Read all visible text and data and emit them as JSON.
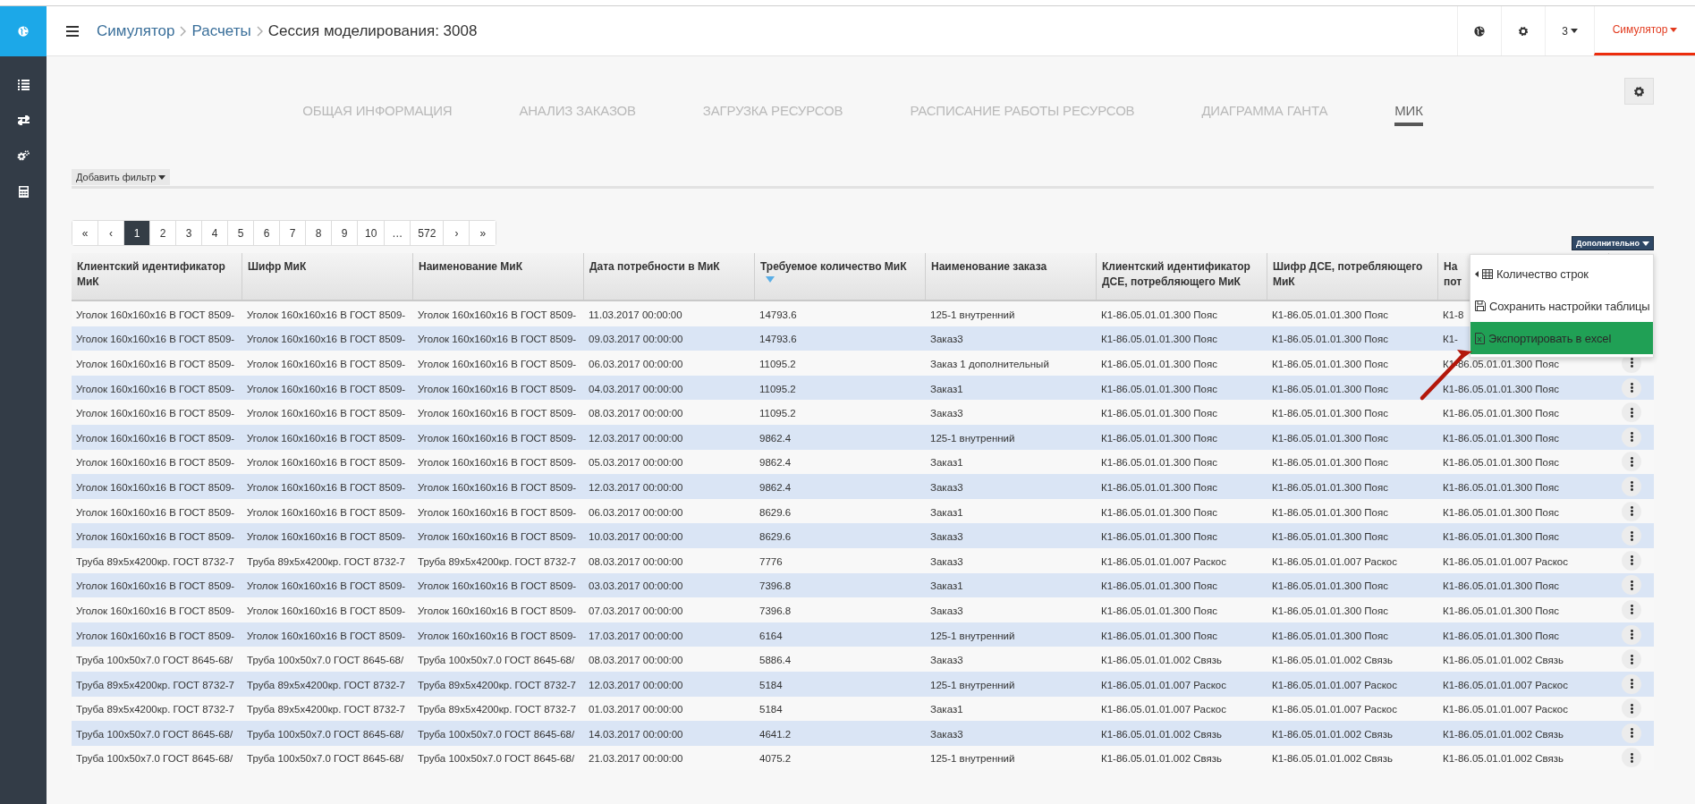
{
  "header": {
    "breadcrumbs": [
      "Симулятор",
      "Расчеты",
      "Сессия моделирования: 3008"
    ],
    "user_menu": "3",
    "app_menu": {
      "label": "Симулятор",
      "selected": true
    }
  },
  "tabs": [
    {
      "label": "ОБЩАЯ ИНФОРМАЦИЯ",
      "selected": false
    },
    {
      "label": "АНАЛИЗ ЗАКАЗОВ",
      "selected": false
    },
    {
      "label": "ЗАГРУЗКА РЕСУРСОВ",
      "selected": false
    },
    {
      "label": "РАСПИСАНИЕ РАБОТЫ РЕСУРСОВ",
      "selected": false
    },
    {
      "label": "ДИАГРАММА ГАНТА",
      "selected": false
    },
    {
      "label": "МИК",
      "selected": true
    }
  ],
  "filter_button": "Добавить фильтр",
  "pagination": [
    {
      "label": "«",
      "selected": false
    },
    {
      "label": "‹",
      "selected": false
    },
    {
      "label": "1",
      "selected": true
    },
    {
      "label": "2",
      "selected": false
    },
    {
      "label": "3",
      "selected": false
    },
    {
      "label": "4",
      "selected": false
    },
    {
      "label": "5",
      "selected": false
    },
    {
      "label": "6",
      "selected": false
    },
    {
      "label": "7",
      "selected": false
    },
    {
      "label": "8",
      "selected": false
    },
    {
      "label": "9",
      "selected": false
    },
    {
      "label": "10",
      "selected": false
    },
    {
      "label": "…",
      "selected": false
    },
    {
      "label": "572",
      "selected": false
    },
    {
      "label": "›",
      "selected": false
    },
    {
      "label": "»",
      "selected": false
    }
  ],
  "more_button": "Дополнительно",
  "more_menu": [
    {
      "kind": "submenu",
      "label": "Количество строк",
      "highlighted": false
    },
    {
      "kind": "save",
      "label": "Сохранить настройки таблицы",
      "highlighted": false
    },
    {
      "kind": "excel",
      "label": "Экспортировать в excel",
      "highlighted": true
    }
  ],
  "table": {
    "columns": [
      {
        "label": "Клиентский идентификатор МиК",
        "sorted": false
      },
      {
        "label": "Шифр МиК",
        "sorted": false
      },
      {
        "label": "Наименование МиК",
        "sorted": false
      },
      {
        "label": "Дата потребности в МиК",
        "sorted": false
      },
      {
        "label": "Требуемое количество МиК",
        "sorted": true
      },
      {
        "label": "Наименование заказа",
        "sorted": false
      },
      {
        "label": "Клиентский идентификатор ДСЕ, потребляющего МиК",
        "sorted": false
      },
      {
        "label": "Шифр ДСЕ, потребляющего МиК",
        "sorted": false
      },
      {
        "label": "На пот",
        "sorted": false
      }
    ],
    "rows": [
      {
        "actions": false,
        "cells": [
          "Уголок 160x160x16 В ГОСТ 8509-",
          "Уголок 160x160x16 В ГОСТ 8509-",
          "Уголок 160x160x16 В ГОСТ 8509-",
          "11.03.2017 00:00:00",
          "14793.6",
          "125-1 внутренний",
          "К1-86.05.01.01.300 Пояс",
          "К1-86.05.01.01.300 Пояс",
          "К1-8"
        ]
      },
      {
        "actions": false,
        "cells": [
          "Уголок 160x160x16 В ГОСТ 8509-",
          "Уголок 160x160x16 В ГОСТ 8509-",
          "Уголок 160x160x16 В ГОСТ 8509-",
          "09.03.2017 00:00:00",
          "14793.6",
          "Заказ3",
          "К1-86.05.01.01.300 Пояс",
          "К1-86.05.01.01.300 Пояс",
          "К1-"
        ]
      },
      {
        "actions": true,
        "cells": [
          "Уголок 160x160x16 В ГОСТ 8509-",
          "Уголок 160x160x16 В ГОСТ 8509-",
          "Уголок 160x160x16 В ГОСТ 8509-",
          "06.03.2017 00:00:00",
          "11095.2",
          "Заказ 1 дополнительный",
          "К1-86.05.01.01.300 Пояс",
          "К1-86.05.01.01.300 Пояс",
          "К1-86.05.01.01.300 Пояс"
        ]
      },
      {
        "actions": true,
        "cells": [
          "Уголок 160x160x16 В ГОСТ 8509-",
          "Уголок 160x160x16 В ГОСТ 8509-",
          "Уголок 160x160x16 В ГОСТ 8509-",
          "04.03.2017 00:00:00",
          "11095.2",
          "Заказ1",
          "К1-86.05.01.01.300 Пояс",
          "К1-86.05.01.01.300 Пояс",
          "К1-86.05.01.01.300 Пояс"
        ]
      },
      {
        "actions": true,
        "cells": [
          "Уголок 160x160x16 В ГОСТ 8509-",
          "Уголок 160x160x16 В ГОСТ 8509-",
          "Уголок 160x160x16 В ГОСТ 8509-",
          "08.03.2017 00:00:00",
          "11095.2",
          "Заказ3",
          "К1-86.05.01.01.300 Пояс",
          "К1-86.05.01.01.300 Пояс",
          "К1-86.05.01.01.300 Пояс"
        ]
      },
      {
        "actions": true,
        "cells": [
          "Уголок 160x160x16 В ГОСТ 8509-",
          "Уголок 160x160x16 В ГОСТ 8509-",
          "Уголок 160x160x16 В ГОСТ 8509-",
          "12.03.2017 00:00:00",
          "9862.4",
          "125-1 внутренний",
          "К1-86.05.01.01.300 Пояс",
          "К1-86.05.01.01.300 Пояс",
          "К1-86.05.01.01.300 Пояс"
        ]
      },
      {
        "actions": true,
        "cells": [
          "Уголок 160x160x16 В ГОСТ 8509-",
          "Уголок 160x160x16 В ГОСТ 8509-",
          "Уголок 160x160x16 В ГОСТ 8509-",
          "05.03.2017 00:00:00",
          "9862.4",
          "Заказ1",
          "К1-86.05.01.01.300 Пояс",
          "К1-86.05.01.01.300 Пояс",
          "К1-86.05.01.01.300 Пояс"
        ]
      },
      {
        "actions": true,
        "cells": [
          "Уголок 160x160x16 В ГОСТ 8509-",
          "Уголок 160x160x16 В ГОСТ 8509-",
          "Уголок 160x160x16 В ГОСТ 8509-",
          "12.03.2017 00:00:00",
          "9862.4",
          "Заказ3",
          "К1-86.05.01.01.300 Пояс",
          "К1-86.05.01.01.300 Пояс",
          "К1-86.05.01.01.300 Пояс"
        ]
      },
      {
        "actions": true,
        "cells": [
          "Уголок 160x160x16 В ГОСТ 8509-",
          "Уголок 160x160x16 В ГОСТ 8509-",
          "Уголок 160x160x16 В ГОСТ 8509-",
          "06.03.2017 00:00:00",
          "8629.6",
          "Заказ1",
          "К1-86.05.01.01.300 Пояс",
          "К1-86.05.01.01.300 Пояс",
          "К1-86.05.01.01.300 Пояс"
        ]
      },
      {
        "actions": true,
        "cells": [
          "Уголок 160x160x16 В ГОСТ 8509-",
          "Уголок 160x160x16 В ГОСТ 8509-",
          "Уголок 160x160x16 В ГОСТ 8509-",
          "10.03.2017 00:00:00",
          "8629.6",
          "Заказ3",
          "К1-86.05.01.01.300 Пояс",
          "К1-86.05.01.01.300 Пояс",
          "К1-86.05.01.01.300 Пояс"
        ]
      },
      {
        "actions": true,
        "cells": [
          "Труба 89x5x4200кр. ГОСТ 8732-7",
          "Труба 89x5x4200кр. ГОСТ 8732-7",
          "Труба 89x5x4200кр. ГОСТ 8732-7",
          "08.03.2017 00:00:00",
          "7776",
          "Заказ3",
          "К1-86.05.01.01.007 Раскос",
          "К1-86.05.01.01.007 Раскос",
          "К1-86.05.01.01.007 Раскос"
        ]
      },
      {
        "actions": true,
        "cells": [
          "Уголок 160x160x16 В ГОСТ 8509-",
          "Уголок 160x160x16 В ГОСТ 8509-",
          "Уголок 160x160x16 В ГОСТ 8509-",
          "03.03.2017 00:00:00",
          "7396.8",
          "Заказ1",
          "К1-86.05.01.01.300 Пояс",
          "К1-86.05.01.01.300 Пояс",
          "К1-86.05.01.01.300 Пояс"
        ]
      },
      {
        "actions": true,
        "cells": [
          "Уголок 160x160x16 В ГОСТ 8509-",
          "Уголок 160x160x16 В ГОСТ 8509-",
          "Уголок 160x160x16 В ГОСТ 8509-",
          "07.03.2017 00:00:00",
          "7396.8",
          "Заказ3",
          "К1-86.05.01.01.300 Пояс",
          "К1-86.05.01.01.300 Пояс",
          "К1-86.05.01.01.300 Пояс"
        ]
      },
      {
        "actions": true,
        "cells": [
          "Уголок 160x160x16 В ГОСТ 8509-",
          "Уголок 160x160x16 В ГОСТ 8509-",
          "Уголок 160x160x16 В ГОСТ 8509-",
          "17.03.2017 00:00:00",
          "6164",
          "125-1 внутренний",
          "К1-86.05.01.01.300 Пояс",
          "К1-86.05.01.01.300 Пояс",
          "К1-86.05.01.01.300 Пояс"
        ]
      },
      {
        "actions": true,
        "cells": [
          "Труба 100x50x7.0 ГОСТ 8645-68/",
          "Труба 100x50x7.0 ГОСТ 8645-68/",
          "Труба 100x50x7.0 ГОСТ 8645-68/",
          "08.03.2017 00:00:00",
          "5886.4",
          "Заказ3",
          "К1-86.05.01.01.002 Связь",
          "К1-86.05.01.01.002 Связь",
          "К1-86.05.01.01.002 Связь"
        ]
      },
      {
        "actions": true,
        "cells": [
          "Труба 89x5x4200кр. ГОСТ 8732-7",
          "Труба 89x5x4200кр. ГОСТ 8732-7",
          "Труба 89x5x4200кр. ГОСТ 8732-7",
          "12.03.2017 00:00:00",
          "5184",
          "125-1 внутренний",
          "К1-86.05.01.01.007 Раскос",
          "К1-86.05.01.01.007 Раскос",
          "К1-86.05.01.01.007 Раскос"
        ]
      },
      {
        "actions": true,
        "cells": [
          "Труба 89x5x4200кр. ГОСТ 8732-7",
          "Труба 89x5x4200кр. ГОСТ 8732-7",
          "Труба 89x5x4200кр. ГОСТ 8732-7",
          "01.03.2017 00:00:00",
          "5184",
          "Заказ1",
          "К1-86.05.01.01.007 Раскос",
          "К1-86.05.01.01.007 Раскос",
          "К1-86.05.01.01.007 Раскос"
        ]
      },
      {
        "actions": true,
        "cells": [
          "Труба 100x50x7.0 ГОСТ 8645-68/",
          "Труба 100x50x7.0 ГОСТ 8645-68/",
          "Труба 100x50x7.0 ГОСТ 8645-68/",
          "14.03.2017 00:00:00",
          "4641.2",
          "Заказ3",
          "К1-86.05.01.01.002 Связь",
          "К1-86.05.01.01.002 Связь",
          "К1-86.05.01.01.002 Связь"
        ]
      },
      {
        "actions": true,
        "cells": [
          "Труба 100x50x7.0 ГОСТ 8645-68/",
          "Труба 100x50x7.0 ГОСТ 8645-68/",
          "Труба 100x50x7.0 ГОСТ 8645-68/",
          "21.03.2017 00:00:00",
          "4075.2",
          "125-1 внутренний",
          "К1-86.05.01.01.002 Связь",
          "К1-86.05.01.01.002 Связь",
          "К1-86.05.01.01.002 Связь"
        ]
      }
    ]
  }
}
